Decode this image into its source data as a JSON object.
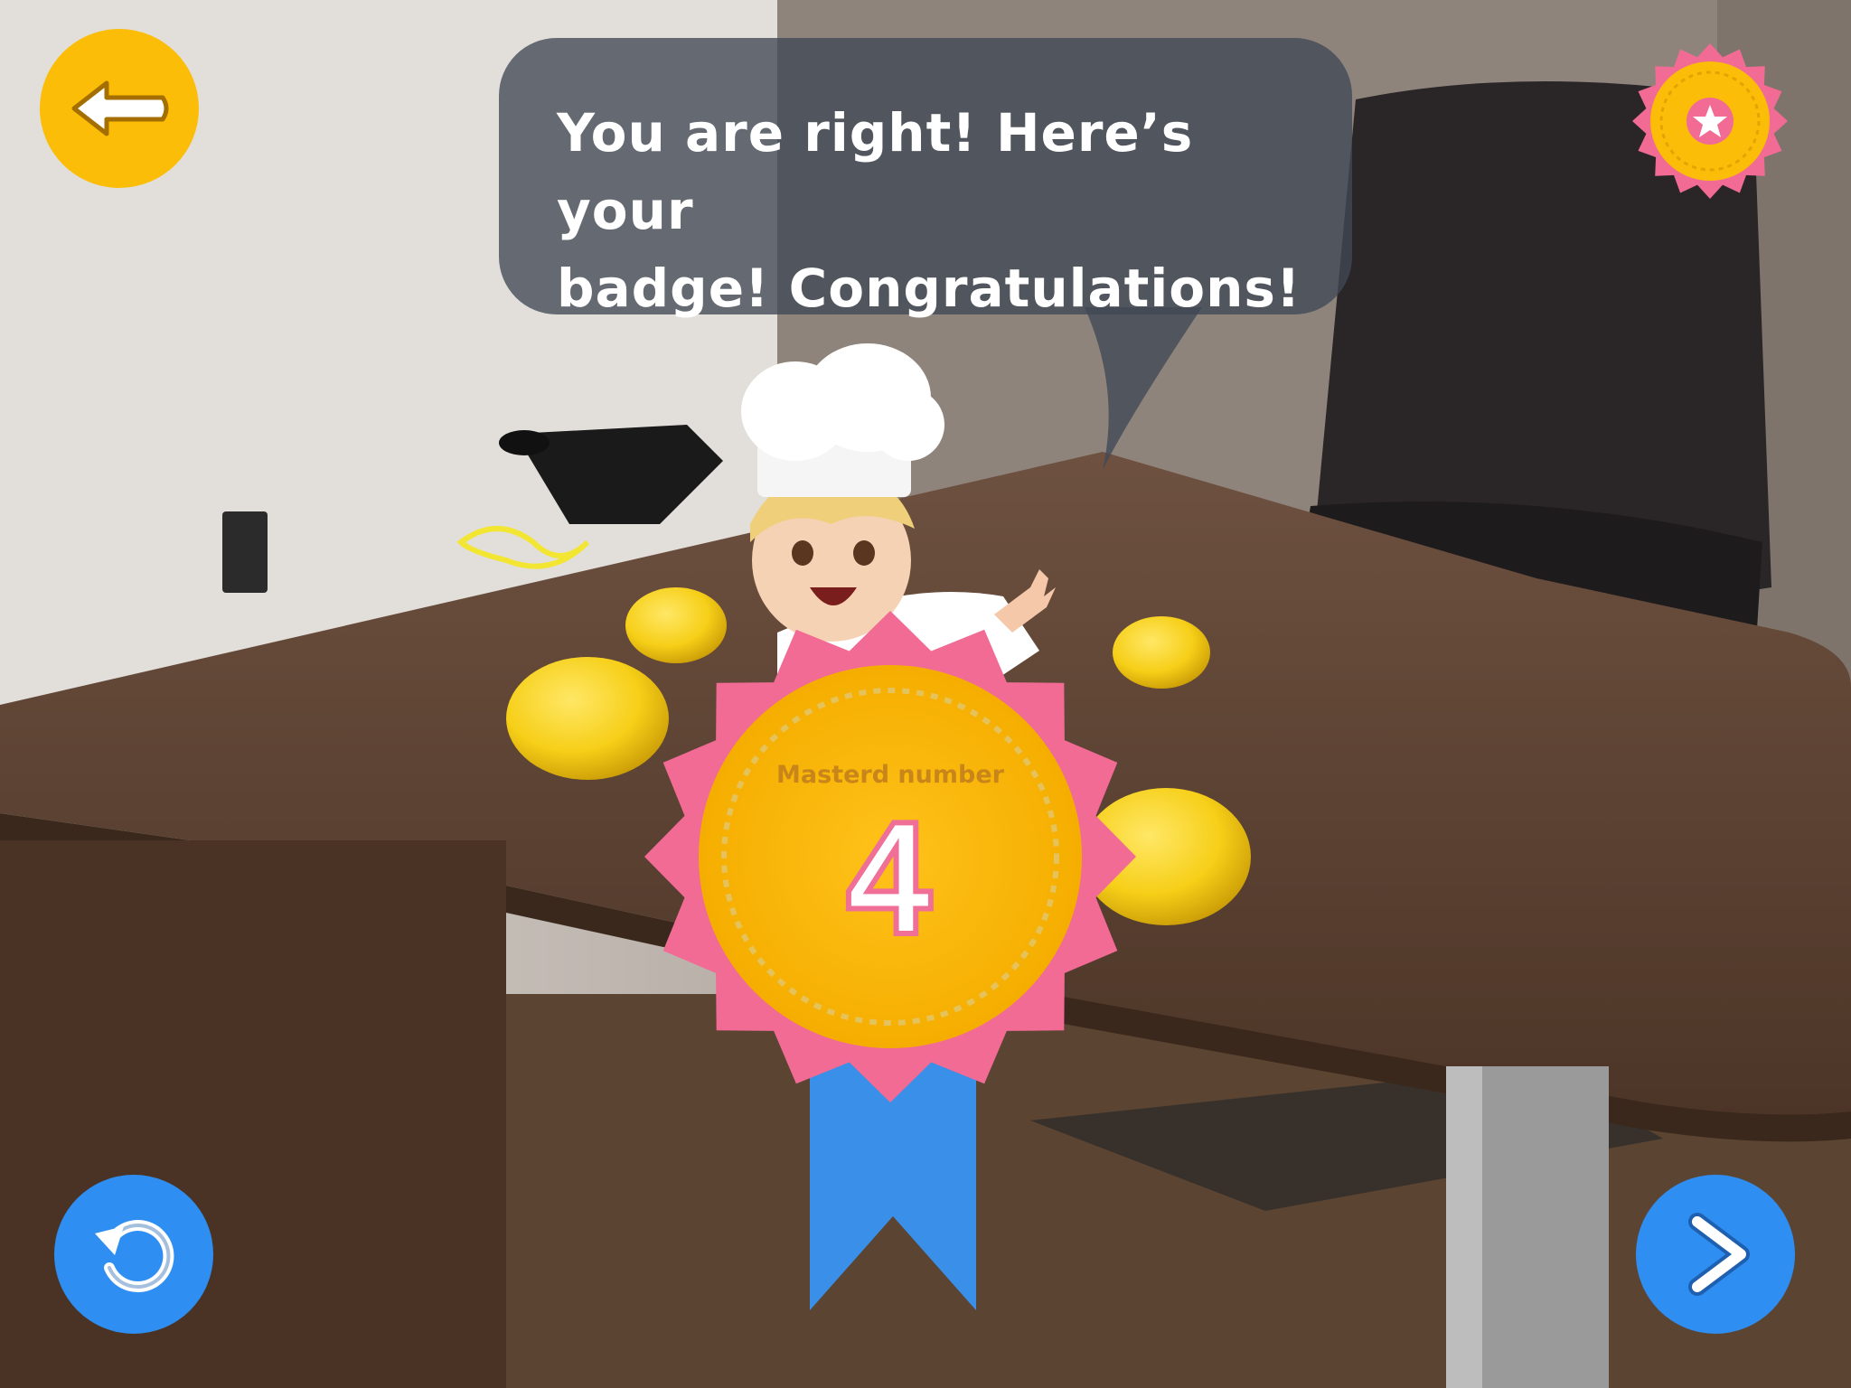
{
  "nav": {
    "back_button": "arrow-left-icon",
    "badges_button": "star-badge-icon",
    "replay_button": "replay-icon",
    "next_button": "chevron-right-icon"
  },
  "dialog": {
    "line1": "You are right! Here’s your",
    "line2": "badge! Congratulations!"
  },
  "badge": {
    "label": "Masterd number",
    "number": "4"
  },
  "colors": {
    "accent_yellow": "#fbbd08",
    "badge_pink": "#f16b94",
    "button_blue": "#2f8ef1",
    "ribbon_blue": "#3a8fe8",
    "bubble_gray": "#4a525e"
  }
}
